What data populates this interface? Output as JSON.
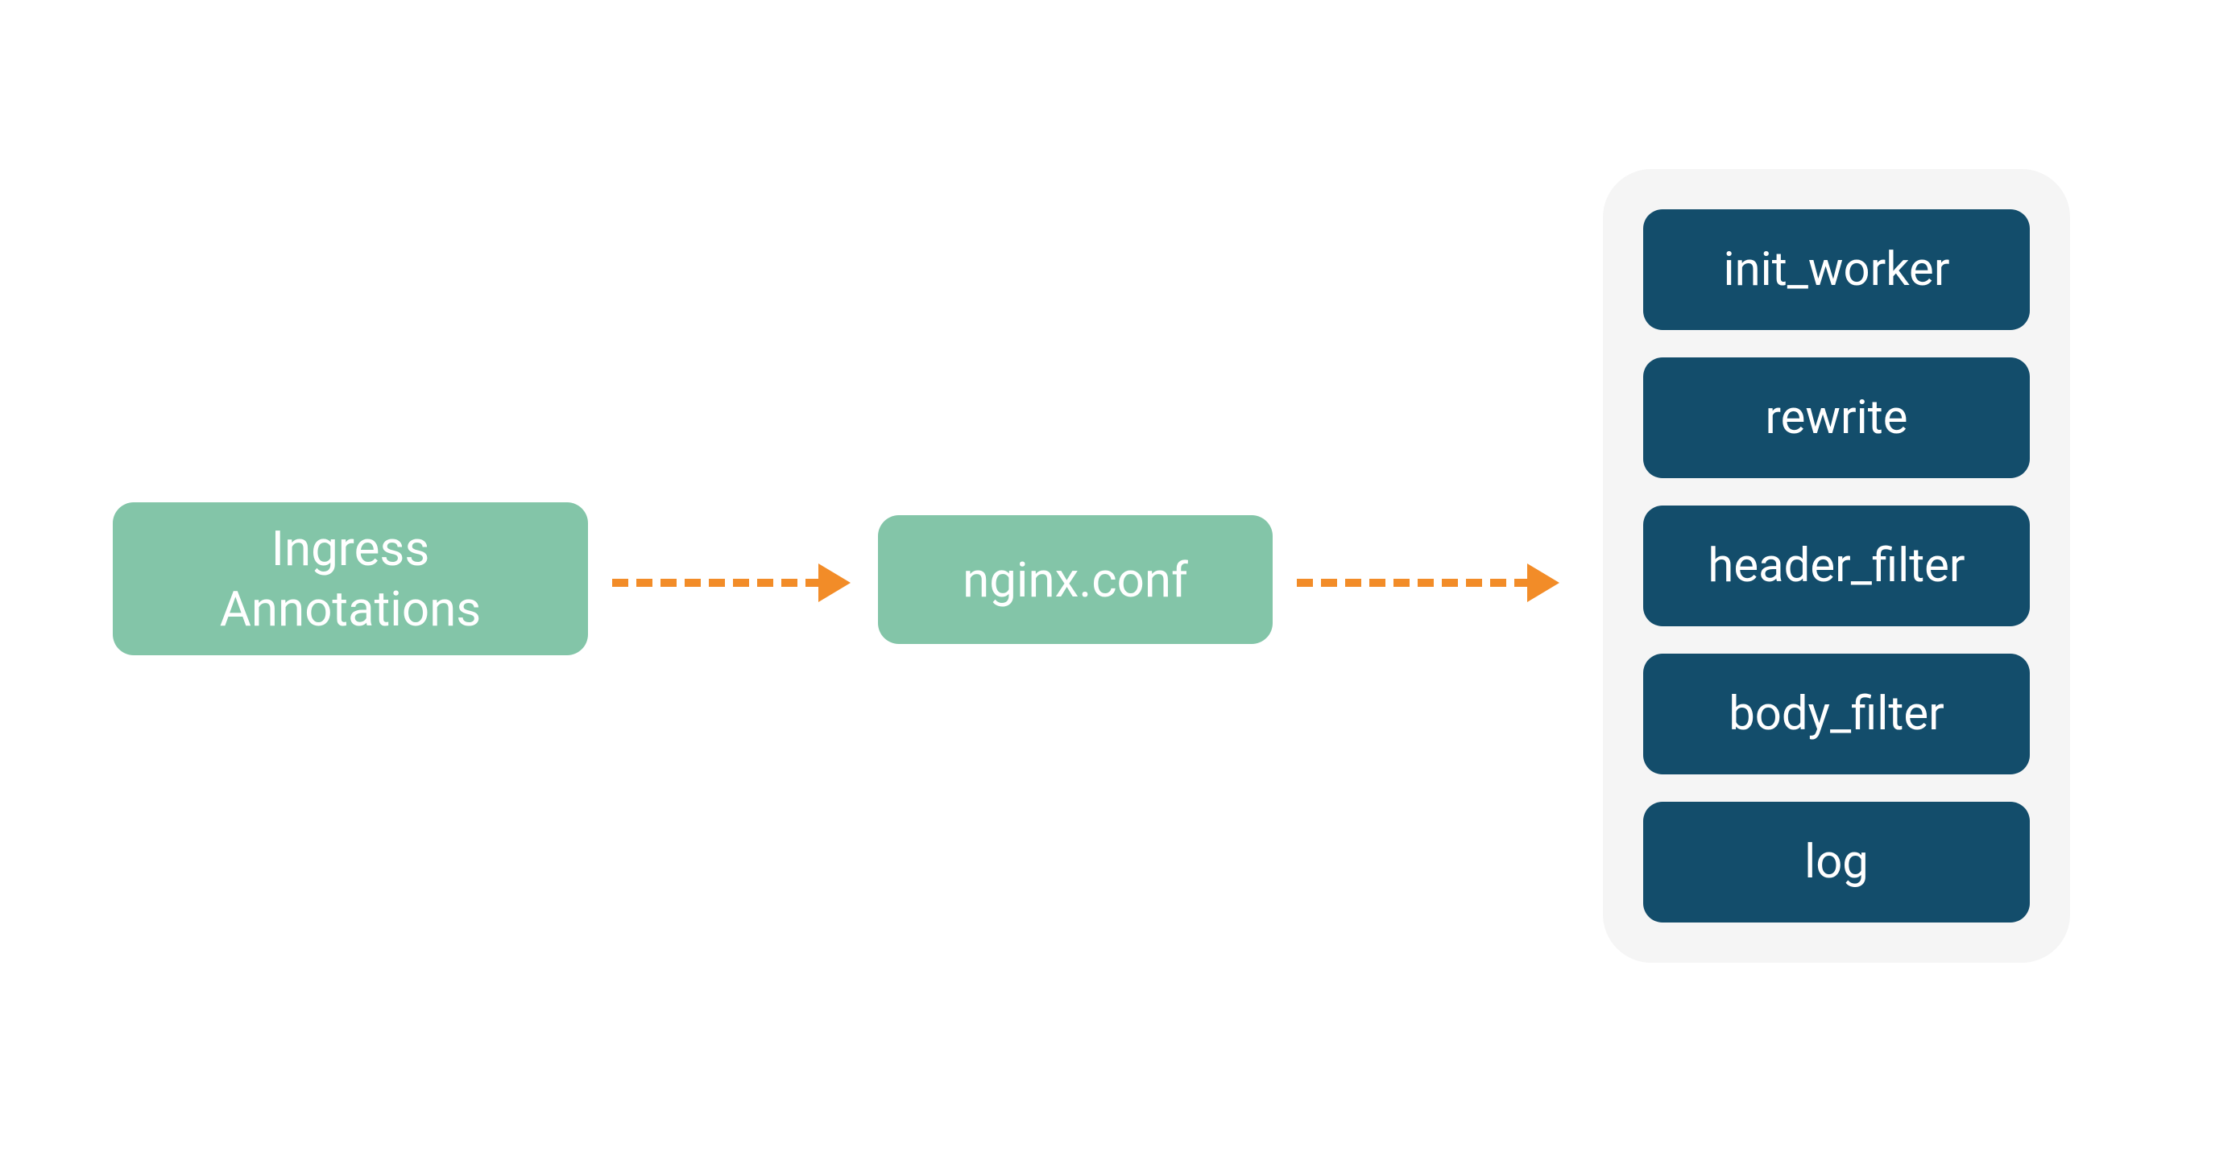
{
  "colors": {
    "green": "#83c5a8",
    "dark": "#134d6b",
    "orange": "#f28c28",
    "grey": "#f5f5f5"
  },
  "nodes": {
    "ingress": {
      "line1": "Ingress",
      "line2": "Annotations"
    },
    "nginx": {
      "label": "nginx.conf"
    }
  },
  "phases": [
    "init_worker",
    "rewrite",
    "header_filter",
    "body_filter",
    "log"
  ]
}
